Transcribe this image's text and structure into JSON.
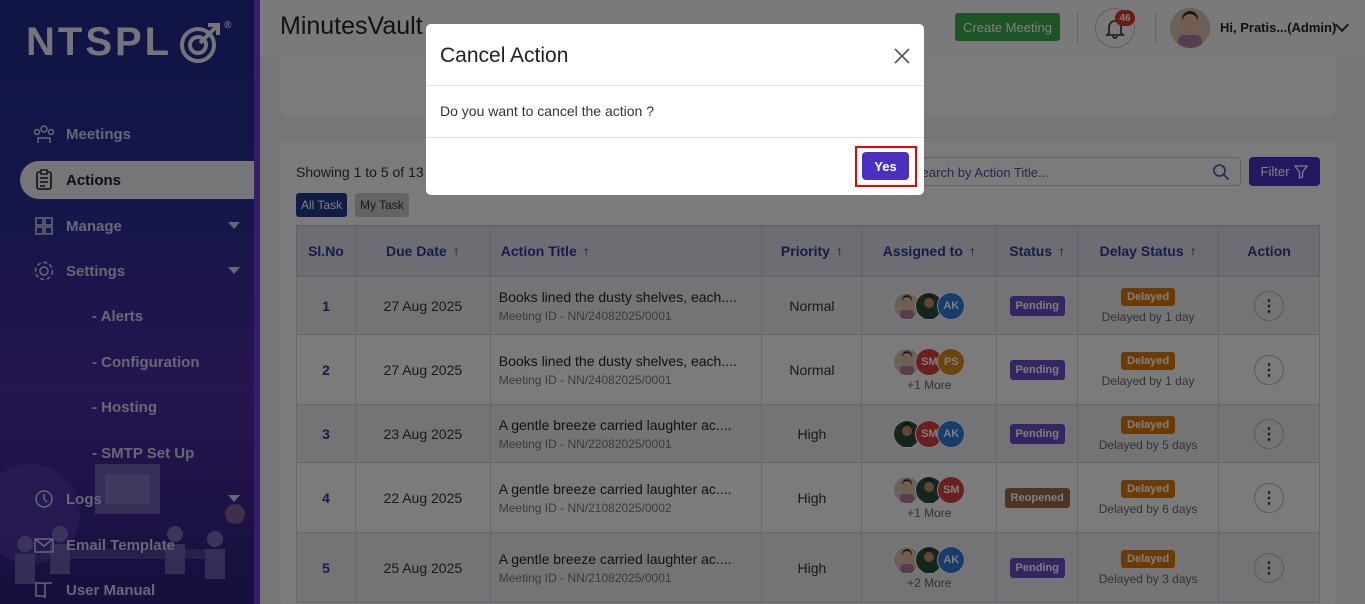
{
  "sidebar": {
    "logo_text": "NTSPL",
    "logo_reg": "®",
    "items": [
      {
        "label": "Meetings",
        "icon": "meetings-icon"
      },
      {
        "label": "Actions",
        "icon": "clipboard-icon"
      },
      {
        "label": "Manage",
        "icon": "grid-icon"
      },
      {
        "label": "Settings",
        "icon": "gear-icon"
      },
      {
        "label": "- Alerts"
      },
      {
        "label": "- Configuration"
      },
      {
        "label": "- Hosting"
      },
      {
        "label": "- SMTP Set Up"
      },
      {
        "label": "Logs",
        "icon": "history-icon"
      },
      {
        "label": "Email Template",
        "icon": "envelope-icon"
      },
      {
        "label": "User Manual",
        "icon": "book-icon"
      }
    ]
  },
  "header": {
    "app_title": "MinutesVault",
    "create_meeting": "Create Meeting",
    "notification_count": "46",
    "user_name": "Hi, Pratis...(Admin)"
  },
  "list": {
    "showing": "Showing 1 to 5 of 13",
    "tabs": [
      "All Task",
      "My Task"
    ],
    "search_placeholder": "Search by Action Title...",
    "filter_label": "Filter",
    "columns": [
      "Sl.No",
      "Due Date",
      "Action Title",
      "Priority",
      "Assigned to",
      "Status",
      "Delay Status",
      "Action"
    ],
    "rows": [
      {
        "sl": "1",
        "due": "27 Aug 2025",
        "title": "Books lined the dusty shelves, each....",
        "meeting": "Meeting ID - NN/24082025/0001",
        "priority": "Normal",
        "avatars": [
          "photo-f",
          "photo-m",
          "AK"
        ],
        "more": "",
        "status": "Pending",
        "delay": "Delayed",
        "delay_text": "Delayed by 1 day"
      },
      {
        "sl": "2",
        "due": "27 Aug 2025",
        "title": "Books lined the dusty shelves, each....",
        "meeting": "Meeting ID - NN/24082025/0001",
        "priority": "Normal",
        "avatars": [
          "photo-f",
          "SM",
          "PS"
        ],
        "more": "+1 More",
        "status": "Pending",
        "delay": "Delayed",
        "delay_text": "Delayed by 1 day"
      },
      {
        "sl": "3",
        "due": "23 Aug 2025",
        "title": "A gentle breeze carried laughter ac....",
        "meeting": "Meeting ID - NN/22082025/0001",
        "priority": "High",
        "avatars": [
          "photo-m",
          "SM",
          "AK"
        ],
        "more": "",
        "status": "Pending",
        "delay": "Delayed",
        "delay_text": "Delayed by 5 days"
      },
      {
        "sl": "4",
        "due": "22 Aug 2025",
        "title": "A gentle breeze carried laughter ac....",
        "meeting": "Meeting ID - NN/21082025/0002",
        "priority": "High",
        "avatars": [
          "photo-f",
          "photo-m",
          "SM"
        ],
        "more": "+1 More",
        "status": "Reopened",
        "delay": "Delayed",
        "delay_text": "Delayed by 6 days"
      },
      {
        "sl": "5",
        "due": "25 Aug 2025",
        "title": "A gentle breeze carried laughter ac....",
        "meeting": "Meeting ID - NN/21082025/0001",
        "priority": "High",
        "avatars": [
          "photo-f",
          "photo-m",
          "AK"
        ],
        "more": "+2 More",
        "status": "Pending",
        "delay": "Delayed",
        "delay_text": "Delayed by 3 days"
      }
    ]
  },
  "modal": {
    "title": "Cancel Action",
    "body": "Do you want to cancel the action ?",
    "yes": "Yes"
  },
  "colors": {
    "primary": "#4b2fc0",
    "navy": "#2b3990",
    "pending": "#6a4bc4",
    "reopened": "#9a6a4a",
    "delayed": "#d97706",
    "green": "#3aa84a"
  }
}
